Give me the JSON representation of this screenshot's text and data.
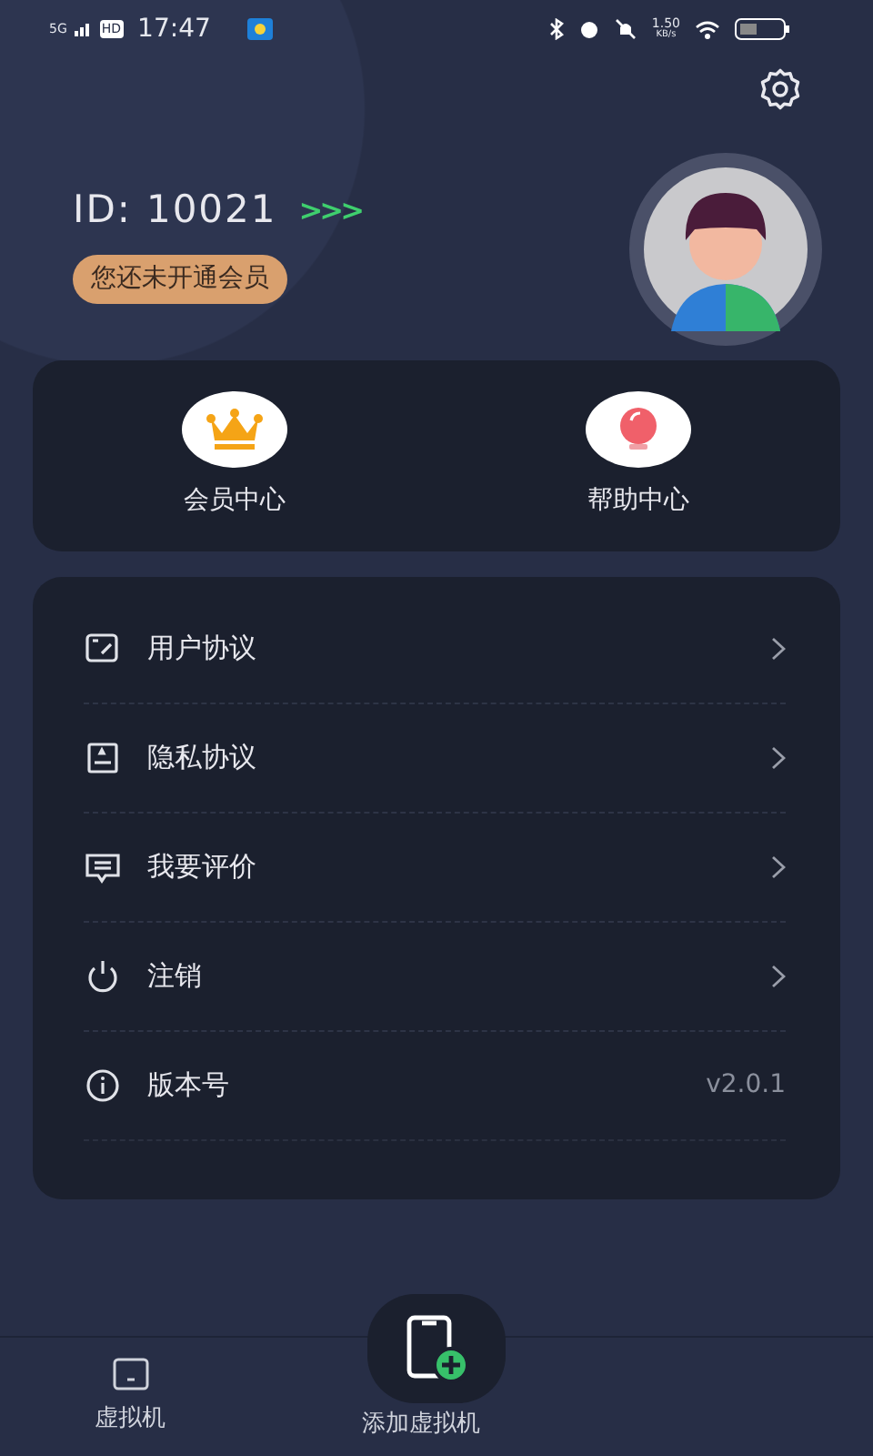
{
  "status_bar": {
    "network": "5G",
    "hd": "HD",
    "time": "17:47",
    "speed": "1.50",
    "speed_unit": "KB/s"
  },
  "profile": {
    "id_label": "ID:",
    "id": "10021",
    "arrows": ">>>",
    "membership": "您还未开通会员"
  },
  "shortcuts": [
    {
      "label": "会员中心",
      "kind": "crown"
    },
    {
      "label": "帮助中心",
      "kind": "bulb"
    }
  ],
  "menu": [
    {
      "label": "用户协议",
      "kind": "link"
    },
    {
      "label": "隐私协议",
      "kind": "link"
    },
    {
      "label": "我要评价",
      "kind": "link"
    },
    {
      "label": "注销",
      "kind": "link"
    },
    {
      "label": "版本号",
      "kind": "value",
      "value": "v2.0.1"
    }
  ],
  "bottom_nav": [
    {
      "label": "虚拟机",
      "kind": "tab"
    },
    {
      "label": "添加虚拟机",
      "kind": "add"
    }
  ]
}
